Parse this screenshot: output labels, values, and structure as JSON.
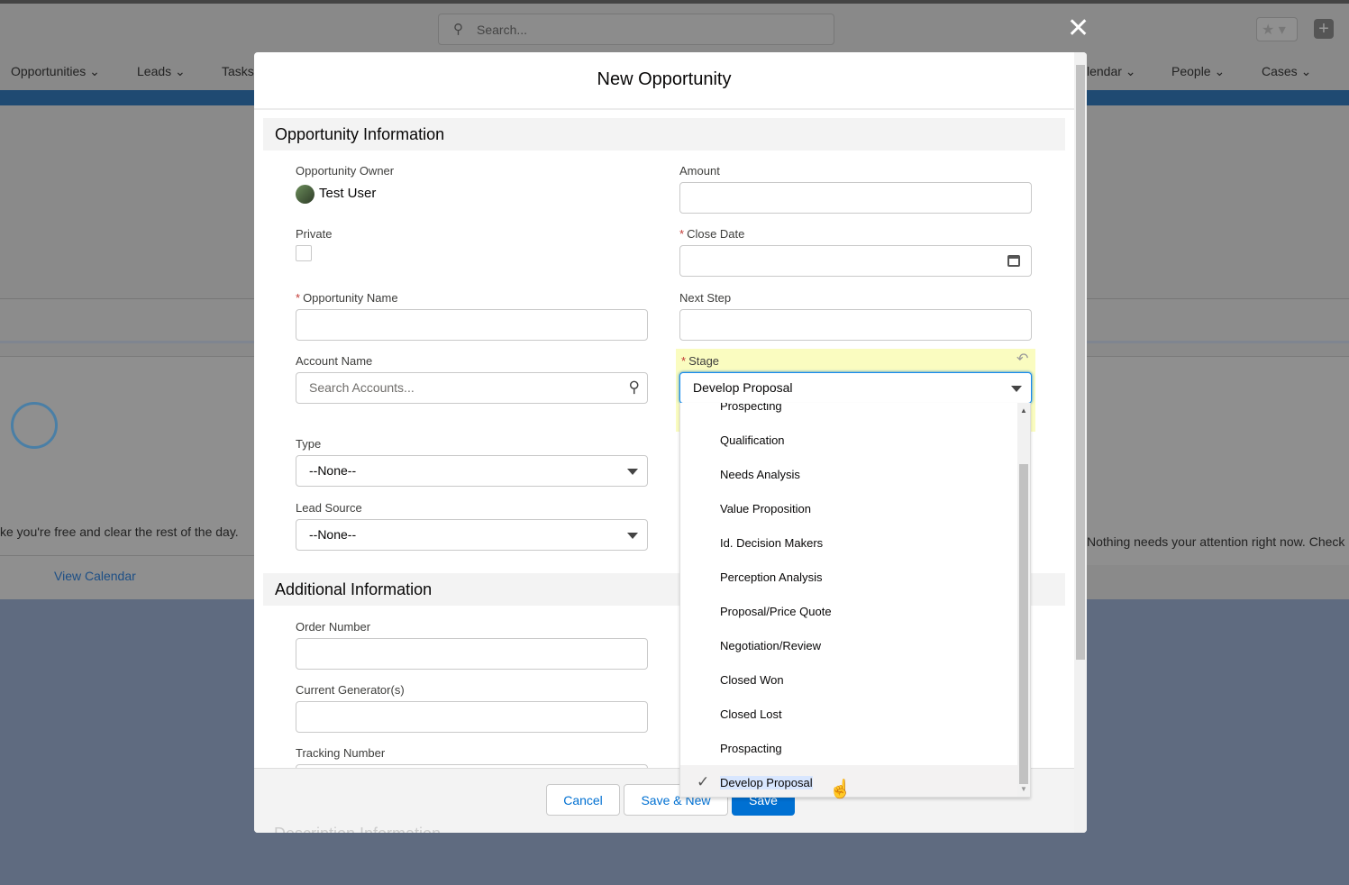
{
  "background": {
    "search_placeholder": "Search...",
    "nav": [
      "Opportunities",
      "Leads",
      "Tasks",
      "lendar",
      "People",
      "Cases"
    ],
    "left_card_text": "ke you're free and clear the rest of the day.",
    "left_card_link": "View Calendar",
    "right_card_text": "Nothing needs your attention right now. Check"
  },
  "modal": {
    "title": "New Opportunity",
    "sections": {
      "opportunity_information": "Opportunity Information",
      "additional_information": "Additional Information",
      "description_information": "Description Information"
    },
    "fields": {
      "owner_label": "Opportunity Owner",
      "owner_value": "Test User",
      "private_label": "Private",
      "name_label": "Opportunity Name",
      "name_value": "",
      "account_label": "Account Name",
      "account_placeholder": "Search Accounts...",
      "type_label": "Type",
      "type_value": "--None--",
      "lead_source_label": "Lead Source",
      "lead_source_value": "--None--",
      "amount_label": "Amount",
      "amount_value": "",
      "close_date_label": "Close Date",
      "close_date_value": "",
      "next_step_label": "Next Step",
      "next_step_value": "",
      "stage_label": "Stage",
      "stage_value": "Develop Proposal",
      "order_number_label": "Order Number",
      "current_generators_label": "Current Generator(s)",
      "tracking_number_label": "Tracking Number"
    },
    "required_mark": "*",
    "stage_options": [
      "Prospecting",
      "Qualification",
      "Needs Analysis",
      "Value Proposition",
      "Id. Decision Makers",
      "Perception Analysis",
      "Proposal/Price Quote",
      "Negotiation/Review",
      "Closed Won",
      "Closed Lost",
      "Prospacting",
      "Develop Proposal"
    ],
    "selected_option": "Develop Proposal",
    "buttons": {
      "cancel": "Cancel",
      "save_new": "Save & New",
      "save": "Save"
    },
    "colors": {
      "brand": "#0070d2",
      "highlight": "#fafcc0",
      "required": "#c23934"
    }
  }
}
